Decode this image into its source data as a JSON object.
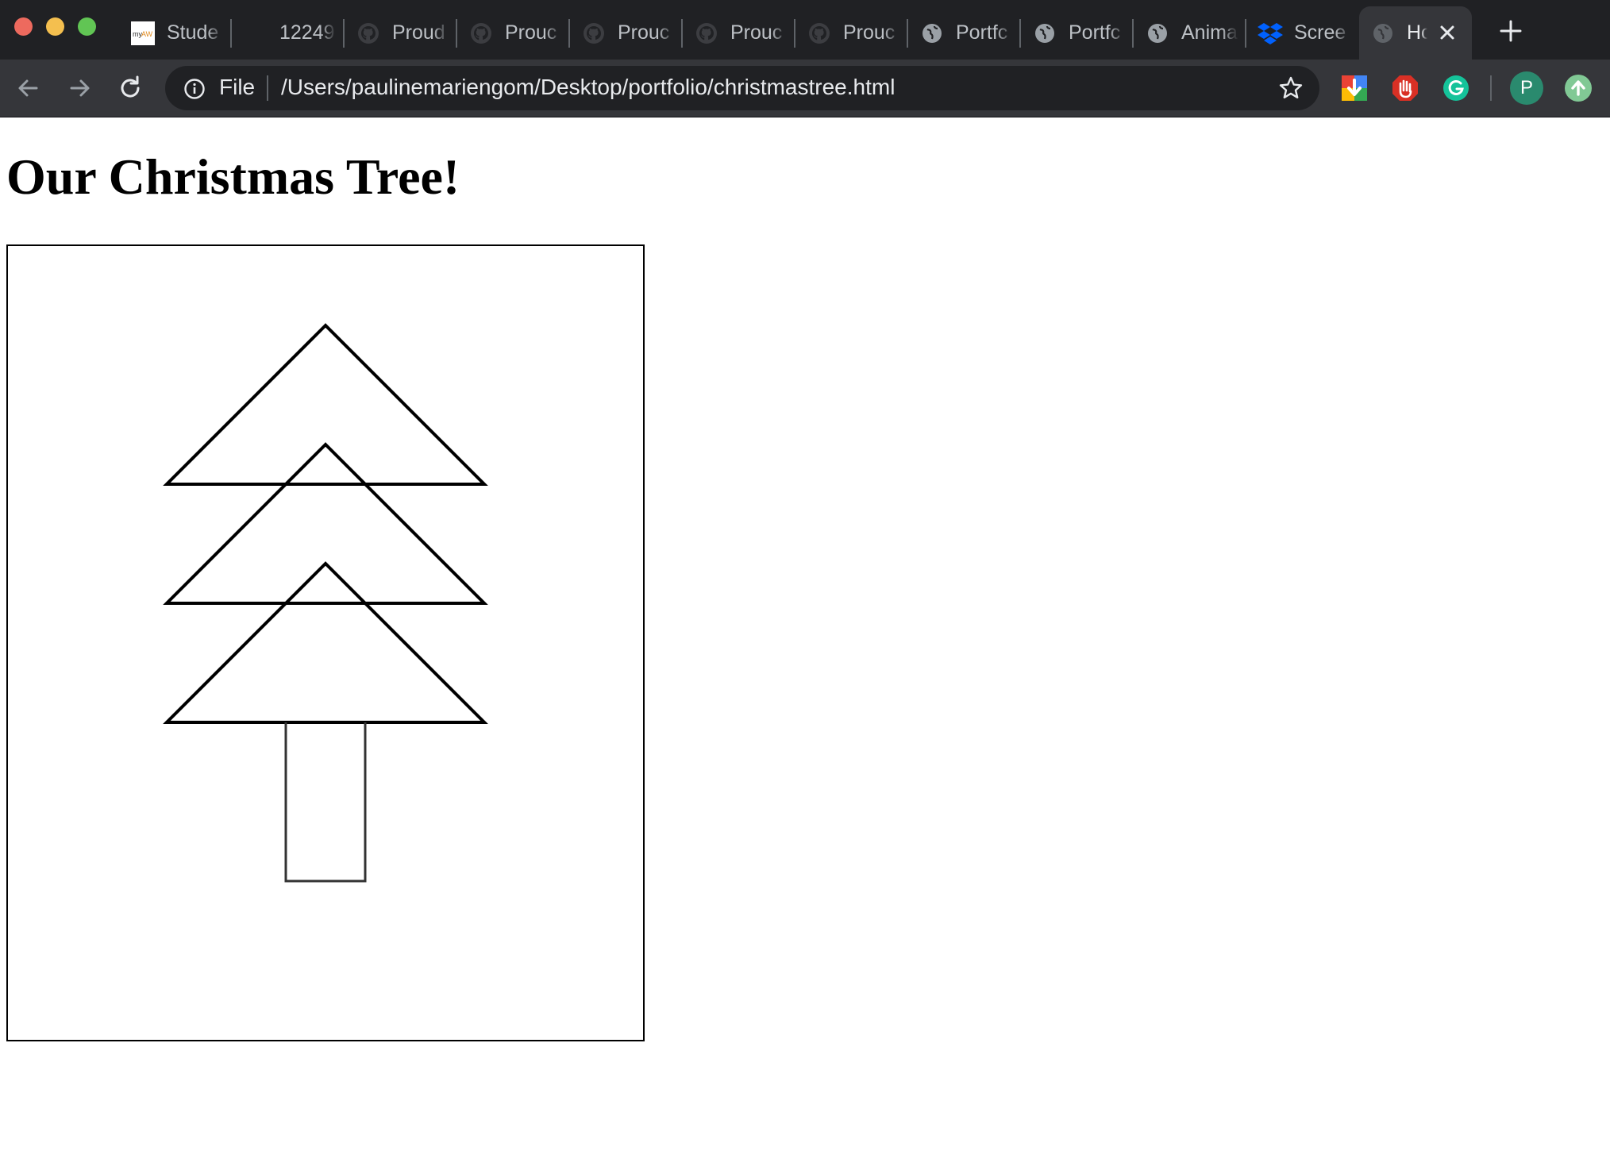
{
  "browser": {
    "tabs": [
      {
        "label": "Stude",
        "icon": "myaw-icon",
        "active": false
      },
      {
        "label": "12249",
        "icon": "",
        "active": false
      },
      {
        "label": "Proud",
        "icon": "github-icon",
        "active": false
      },
      {
        "label": "Prouc",
        "icon": "github-icon",
        "active": false
      },
      {
        "label": "Prouc",
        "icon": "github-icon",
        "active": false
      },
      {
        "label": "Prouc",
        "icon": "github-icon",
        "active": false
      },
      {
        "label": "Prouc",
        "icon": "github-icon",
        "active": false
      },
      {
        "label": "Portfc",
        "icon": "globe-icon",
        "active": false
      },
      {
        "label": "Portfc",
        "icon": "globe-icon",
        "active": false
      },
      {
        "label": "Anima",
        "icon": "globe-icon",
        "active": false
      },
      {
        "label": "Scree",
        "icon": "dropbox-icon",
        "active": false
      },
      {
        "label": "Hc",
        "icon": "globe-icon",
        "active": true
      }
    ],
    "address_bar": {
      "scheme_label": "File",
      "url": "/Users/paulinemariengom/Desktop/portfolio/christmastree.html"
    },
    "profile_initial": "P",
    "colors": {
      "chrome_dark": "#202124",
      "toolbar": "#35363a",
      "text": "#e8eaed"
    }
  },
  "page": {
    "title": "Our Christmas Tree!"
  }
}
